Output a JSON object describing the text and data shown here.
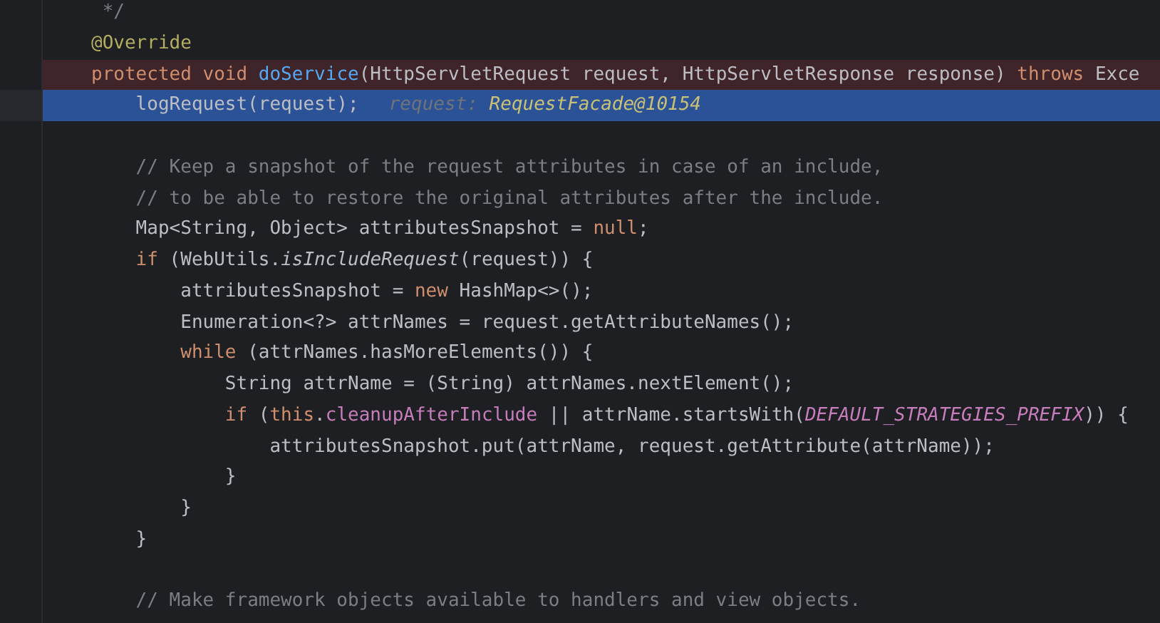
{
  "editor": {
    "lines": [
      {
        "breakpoint": false,
        "execution_point": false,
        "tokens": [
          {
            "text": " */",
            "kind": "comment"
          }
        ]
      },
      {
        "breakpoint": false,
        "execution_point": false,
        "tokens": [
          {
            "text": "@Override",
            "kind": "annotation"
          }
        ]
      },
      {
        "breakpoint": true,
        "execution_point": false,
        "tokens": [
          {
            "text": "protected void ",
            "kind": "keyword"
          },
          {
            "text": "doService",
            "kind": "declaration"
          },
          {
            "text": "(HttpServletRequest request, HttpServletResponse response) ",
            "kind": "plain"
          },
          {
            "text": "throws ",
            "kind": "keyword"
          },
          {
            "text": "Exce",
            "kind": "plain"
          }
        ]
      },
      {
        "breakpoint": false,
        "execution_point": true,
        "tokens": [
          {
            "text": "    logRequest(request);",
            "kind": "plain"
          }
        ],
        "hint": {
          "name": "request:",
          "value": "RequestFacade@10154"
        }
      },
      {
        "breakpoint": false,
        "execution_point": false
      },
      {
        "breakpoint": false,
        "execution_point": false,
        "tokens": [
          {
            "text": "    // Keep a snapshot of the request attributes in case of an include,",
            "kind": "comment"
          }
        ]
      },
      {
        "breakpoint": false,
        "execution_point": false,
        "tokens": [
          {
            "text": "    // to be able to restore the original attributes after the include.",
            "kind": "comment"
          }
        ]
      },
      {
        "breakpoint": false,
        "execution_point": false,
        "tokens": [
          {
            "text": "    Map<String, Object> attributesSnapshot = ",
            "kind": "plain"
          },
          {
            "text": "null",
            "kind": "keyword"
          },
          {
            "text": ";",
            "kind": "plain"
          }
        ]
      },
      {
        "breakpoint": false,
        "execution_point": false,
        "tokens": [
          {
            "text": "    if ",
            "kind": "keyword"
          },
          {
            "text": "(WebUtils.",
            "kind": "plain"
          },
          {
            "text": "isIncludeRequest",
            "kind": "static"
          },
          {
            "text": "(request)) {",
            "kind": "plain"
          }
        ]
      },
      {
        "breakpoint": false,
        "execution_point": false,
        "tokens": [
          {
            "text": "        attributesSnapshot = ",
            "kind": "plain"
          },
          {
            "text": "new ",
            "kind": "keyword"
          },
          {
            "text": "HashMap<>();",
            "kind": "plain"
          }
        ]
      },
      {
        "breakpoint": false,
        "execution_point": false,
        "tokens": [
          {
            "text": "        Enumeration<?> attrNames = request.getAttributeNames();",
            "kind": "plain"
          }
        ]
      },
      {
        "breakpoint": false,
        "execution_point": false,
        "tokens": [
          {
            "text": "        while ",
            "kind": "keyword"
          },
          {
            "text": "(attrNames.hasMoreElements()) {",
            "kind": "plain"
          }
        ]
      },
      {
        "breakpoint": false,
        "execution_point": false,
        "tokens": [
          {
            "text": "            String attrName = (String) attrNames.nextElement();",
            "kind": "plain"
          }
        ]
      },
      {
        "breakpoint": false,
        "execution_point": false,
        "tokens": [
          {
            "text": "            if ",
            "kind": "keyword"
          },
          {
            "text": "(",
            "kind": "plain"
          },
          {
            "text": "this",
            "kind": "keyword"
          },
          {
            "text": ".",
            "kind": "plain"
          },
          {
            "text": "cleanupAfterInclude",
            "kind": "field"
          },
          {
            "text": " || attrName.startsWith(",
            "kind": "plain"
          },
          {
            "text": "DEFAULT_STRATEGIES_PREFIX",
            "kind": "constant"
          },
          {
            "text": ")) {",
            "kind": "plain"
          }
        ]
      },
      {
        "breakpoint": false,
        "execution_point": false,
        "tokens": [
          {
            "text": "                attributesSnapshot.put(attrName, request.getAttribute(attrName));",
            "kind": "plain"
          }
        ]
      },
      {
        "breakpoint": false,
        "execution_point": false,
        "tokens": [
          {
            "text": "            }",
            "kind": "plain"
          }
        ]
      },
      {
        "breakpoint": false,
        "execution_point": false,
        "tokens": [
          {
            "text": "        }",
            "kind": "plain"
          }
        ]
      },
      {
        "breakpoint": false,
        "execution_point": false,
        "tokens": [
          {
            "text": "    }",
            "kind": "plain"
          }
        ]
      },
      {
        "breakpoint": false,
        "execution_point": false
      },
      {
        "breakpoint": false,
        "execution_point": false,
        "tokens": [
          {
            "text": "    // Make framework objects available to handlers and view objects.",
            "kind": "comment"
          }
        ]
      }
    ]
  }
}
